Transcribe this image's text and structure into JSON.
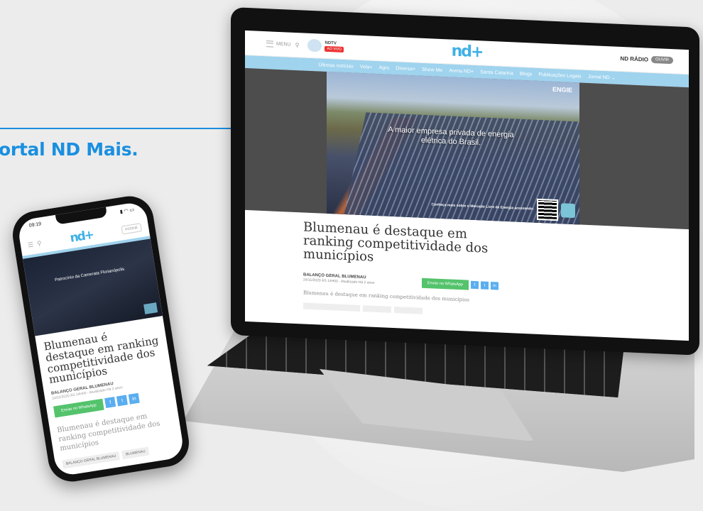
{
  "caption": "ortal ND Mais.",
  "colors": {
    "accent": "#1a8fe0",
    "brand": "#3fb0e6",
    "nav": "#9fd3ee",
    "whatsapp": "#54c36c"
  },
  "laptop": {
    "header": {
      "menu_label": "MENU",
      "tv_label": "NDTV",
      "live_label": "AO VIVO",
      "logo": "nd+",
      "radio_label": "ND RÁDIO",
      "listen_label": "OUVIR"
    },
    "nav": [
      "Últimas notícias",
      "Vela+",
      "Agro",
      "Diversa+",
      "Show Me",
      "Arena ND+",
      "Santa Catarina",
      "Blogs",
      "Publicações Legais",
      "Jornal ND ⌄"
    ],
    "ad": {
      "brand": "ENGIE",
      "headline": "A maior empresa privada de energia elétrica do Brasil.",
      "cta": "Conheça mais sobre o Mercado Livre de Energia acessando:"
    },
    "article": {
      "title": "Blumenau é destaque em ranking competitividade dos municípios",
      "author": "BALANÇO GERAL BLUMENAU",
      "date": "24/11/2020 ÀS 14H00 - Atualizado Há 2 anos",
      "share_whatsapp": "Enviar no WhatsApp",
      "subtitle": "Blumenau é destaque em ranking competitividade dos municípios"
    }
  },
  "phone": {
    "time": "09:19",
    "logo": "nd+",
    "assine": "ASSINE",
    "hero_text": "Patrocínio da Camerata Florianópolis",
    "article": {
      "title": "Blumenau é destaque em ranking competitividade dos municípios",
      "author": "BALANÇO GERAL BLUMENAU",
      "date": "24/11/2020 ÀS 14H00 - Atualizado Há 2 anos",
      "share_whatsapp": "Enviar no WhatsApp",
      "subtitle": "Blumenau é destaque em ranking competitividade dos municípios"
    },
    "tags": [
      "BALANÇO GERAL BLUMENAU",
      "BLUMENAU"
    ]
  }
}
